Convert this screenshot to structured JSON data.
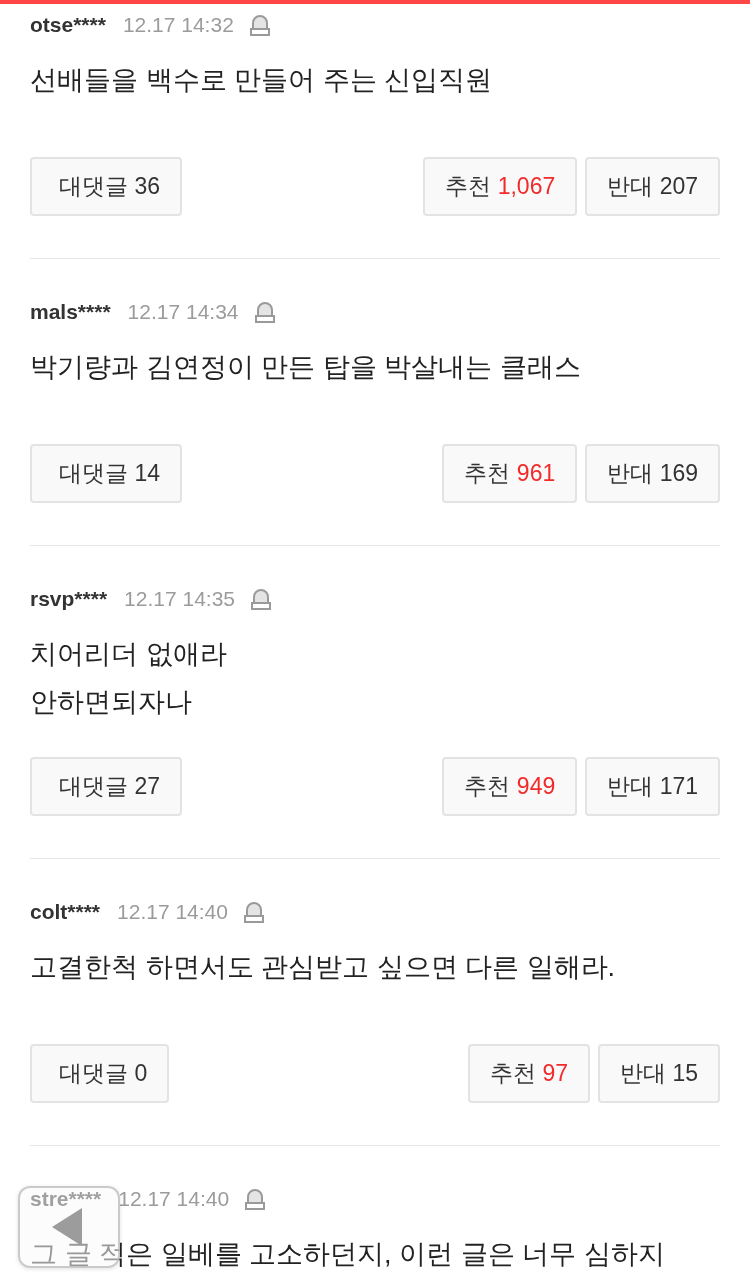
{
  "comments": [
    {
      "user": "otse****",
      "time": "12.17 14:32",
      "text": "선배들을 백수로 만들어 주는 신입직원",
      "actions": [
        {
          "kind": "reply",
          "label": "대댓글",
          "count": "36"
        },
        {
          "kind": "like",
          "label": "추천",
          "count": "1,067"
        },
        {
          "kind": "dislike",
          "label": "반대",
          "count": "207"
        }
      ]
    },
    {
      "user": "mals****",
      "time": "12.17 14:34",
      "text": "박기량과 김연정이 만든 탑을 박살내는 클래스",
      "actions": [
        {
          "kind": "reply",
          "label": "대댓글",
          "count": "14"
        },
        {
          "kind": "like",
          "label": "추천",
          "count": "961"
        },
        {
          "kind": "dislike",
          "label": "반대",
          "count": "169"
        }
      ]
    },
    {
      "user": "rsvp****",
      "time": "12.17 14:35",
      "text": "치어리더 없애라\n안하면되자나",
      "actions": [
        {
          "kind": "reply",
          "label": "대댓글",
          "count": "27"
        },
        {
          "kind": "like",
          "label": "추천",
          "count": "949"
        },
        {
          "kind": "dislike",
          "label": "반대",
          "count": "171"
        }
      ]
    },
    {
      "user": "colt****",
      "time": "12.17 14:40",
      "text": "고결한척 하면서도 관심받고 싶으면 다른 일해라.",
      "actions": [
        {
          "kind": "reply",
          "label": "대댓글",
          "count": "0"
        },
        {
          "kind": "like",
          "label": "추천",
          "count": "97"
        },
        {
          "kind": "dislike",
          "label": "반대",
          "count": "15"
        }
      ]
    },
    {
      "user": "stre****",
      "time": "12.17 14:40",
      "text": "그 글 적은 일베를 고소하던지, 이런 글은 너무 심하지"
    }
  ]
}
